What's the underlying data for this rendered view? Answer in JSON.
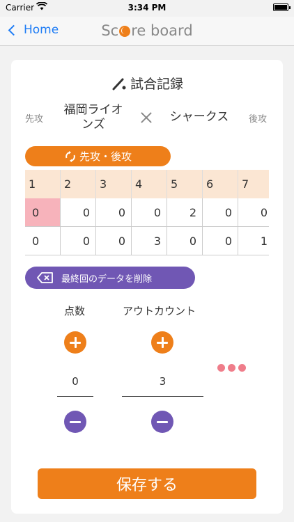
{
  "status_bar": {
    "carrier": "Carrier",
    "time": "3:34 PM"
  },
  "nav": {
    "back_label": "Home",
    "title_prefix": "Sc",
    "title_suffix": "re board"
  },
  "record": {
    "title": "試合記録",
    "first_label": "先攻",
    "second_label": "後攻",
    "team_first": "福岡ライオンズ",
    "team_second": "シャークス"
  },
  "swap_label": "先攻・後攻",
  "scoreboard": {
    "innings": [
      "1",
      "2",
      "3",
      "4",
      "5",
      "6",
      "7",
      ""
    ],
    "first_scores": [
      "0",
      "0",
      "0",
      "0",
      "2",
      "0",
      "0",
      ""
    ],
    "second_scores": [
      "0",
      "0",
      "0",
      "3",
      "0",
      "0",
      "1",
      ""
    ]
  },
  "delete_label": "最終回のデータを削除",
  "controls": {
    "score_label": "点数",
    "out_label": "アウトカウント",
    "score_value": "0",
    "out_value": "3"
  },
  "save_label": "保存する",
  "colors": {
    "accent": "#ee7f1a",
    "purple": "#7057b4",
    "selected": "#f7b3bb",
    "link": "#1e7cf5"
  }
}
